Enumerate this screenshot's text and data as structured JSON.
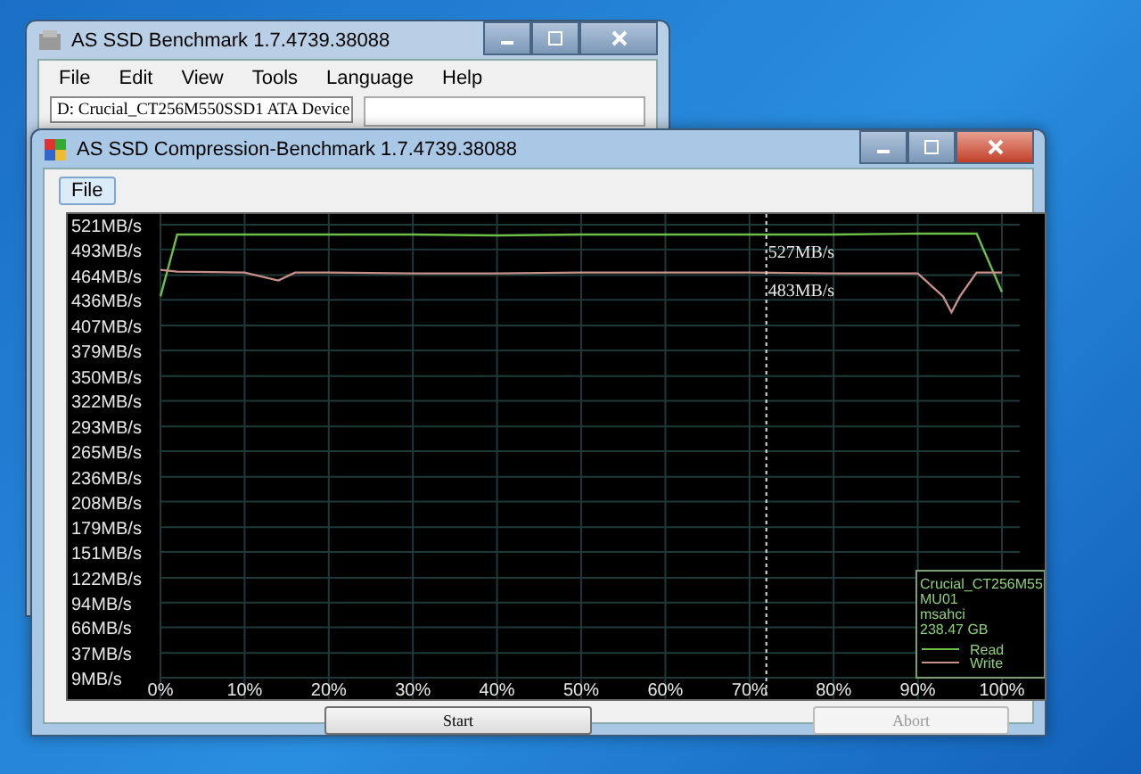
{
  "back_window": {
    "title": "AS SSD Benchmark 1.7.4739.38088",
    "menu": [
      "File",
      "Edit",
      "View",
      "Tools",
      "Language",
      "Help"
    ],
    "drive_select": {
      "value": "D: Crucial_CT256M550SSD1 ATA Device"
    }
  },
  "window": {
    "title": "AS SSD Compression-Benchmark 1.7.4739.38088",
    "menu": [
      {
        "label": "File",
        "selected": true
      }
    ],
    "chart_data": {
      "type": "line",
      "x": [
        0,
        2,
        10,
        14,
        16,
        20,
        30,
        40,
        50,
        60,
        70,
        80,
        90,
        93,
        94,
        95,
        97,
        100
      ],
      "series": [
        {
          "name": "Read",
          "color": "#6cc04a",
          "values": [
            440,
            510,
            510,
            510,
            510,
            510,
            510,
            509,
            510,
            510,
            510,
            510,
            511,
            511,
            511,
            511,
            511,
            445
          ]
        },
        {
          "name": "Write",
          "color": "#c8908a",
          "values": [
            470,
            468,
            467,
            458,
            467,
            467,
            466,
            466,
            467,
            467,
            467,
            466,
            466,
            440,
            422,
            440,
            467,
            467
          ]
        }
      ],
      "xlim": [
        0,
        100
      ],
      "ylim": [
        9,
        521
      ],
      "xticks": [
        {
          "value": 0,
          "label": "0%"
        },
        {
          "value": 10,
          "label": "10%"
        },
        {
          "value": 20,
          "label": "20%"
        },
        {
          "value": 30,
          "label": "30%"
        },
        {
          "value": 40,
          "label": "40%"
        },
        {
          "value": 50,
          "label": "50%"
        },
        {
          "value": 60,
          "label": "60%"
        },
        {
          "value": 70,
          "label": "70%"
        },
        {
          "value": 80,
          "label": "80%"
        },
        {
          "value": 90,
          "label": "90%"
        },
        {
          "value": 100,
          "label": "100%"
        }
      ],
      "yticks": [
        {
          "value": 521,
          "label": "521MB/s"
        },
        {
          "value": 493,
          "label": "493MB/s"
        },
        {
          "value": 464,
          "label": "464MB/s"
        },
        {
          "value": 436,
          "label": "436MB/s"
        },
        {
          "value": 407,
          "label": "407MB/s"
        },
        {
          "value": 379,
          "label": "379MB/s"
        },
        {
          "value": 350,
          "label": "350MB/s"
        },
        {
          "value": 322,
          "label": "322MB/s"
        },
        {
          "value": 293,
          "label": "293MB/s"
        },
        {
          "value": 265,
          "label": "265MB/s"
        },
        {
          "value": 236,
          "label": "236MB/s"
        },
        {
          "value": 208,
          "label": "208MB/s"
        },
        {
          "value": 179,
          "label": "179MB/s"
        },
        {
          "value": 151,
          "label": "151MB/s"
        },
        {
          "value": 122,
          "label": "122MB/s"
        },
        {
          "value": 94,
          "label": "94MB/s"
        },
        {
          "value": 66,
          "label": "66MB/s"
        },
        {
          "value": 37,
          "label": "37MB/s"
        },
        {
          "value": 9,
          "label": "9MB/s"
        }
      ],
      "grid": true,
      "legend": true,
      "ref_lines": [
        {
          "axis": "x",
          "value": 72
        }
      ],
      "annotations": [
        {
          "x": 72,
          "text": "527MB/s"
        },
        {
          "x": 72,
          "text": "483MB/s"
        }
      ]
    },
    "legend_info": {
      "lines": [
        "Crucial_CT256M55",
        "MU01",
        "msahci",
        "238.47 GB"
      ]
    },
    "buttons": [
      {
        "label": "Start",
        "disabled": false
      },
      {
        "label": "Abort",
        "disabled": true
      }
    ]
  }
}
